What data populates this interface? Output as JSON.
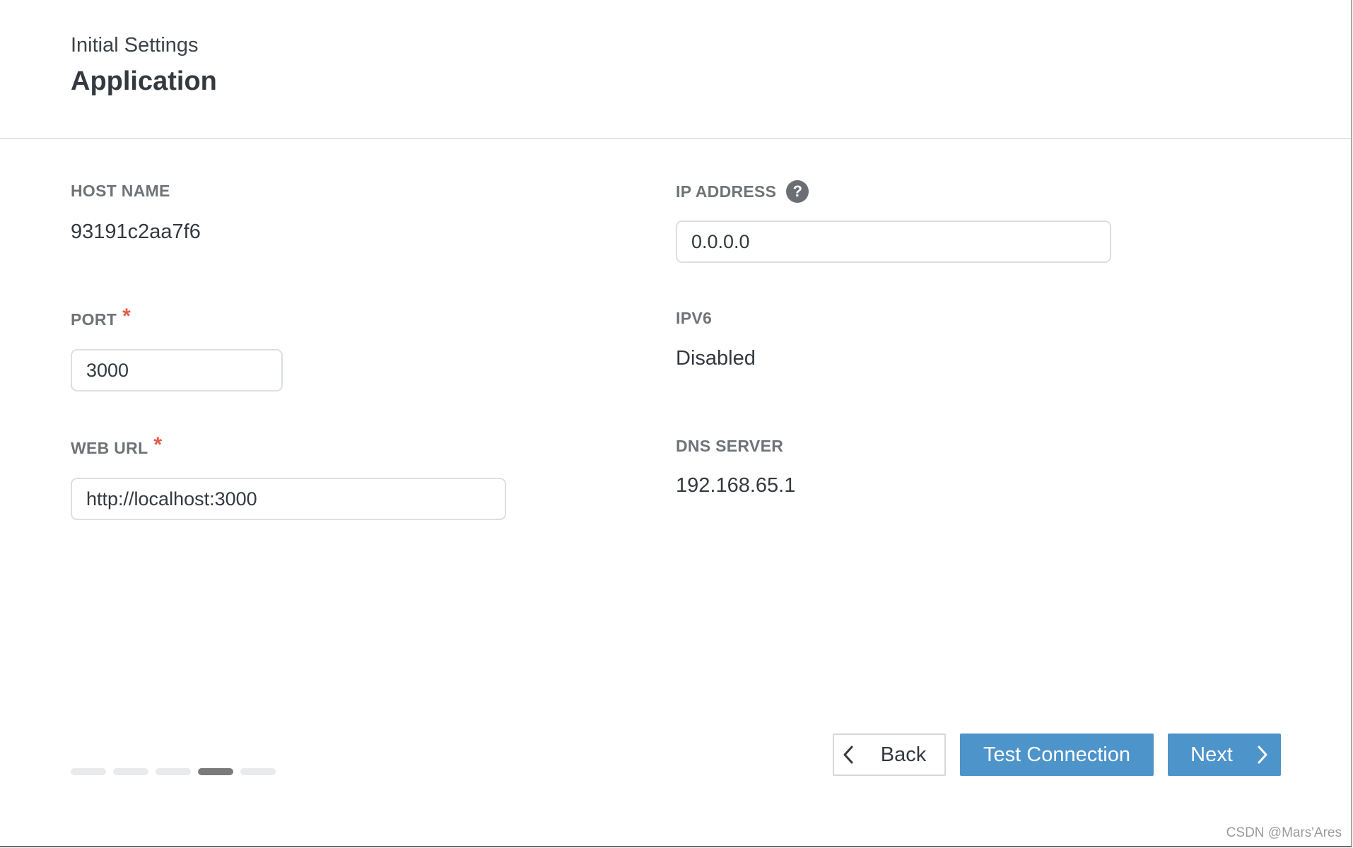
{
  "header": {
    "subtitle": "Initial Settings",
    "title": "Application"
  },
  "fields": {
    "host_name": {
      "label": "HOST NAME",
      "value": "93191c2aa7f6"
    },
    "ip_address": {
      "label": "IP ADDRESS",
      "help_icon": "?",
      "value": "0.0.0.0"
    },
    "port": {
      "label": "PORT",
      "required_mark": "*",
      "value": "3000"
    },
    "ipv6": {
      "label": "IPV6",
      "value": "Disabled"
    },
    "web_url": {
      "label": "WEB URL",
      "required_mark": "*",
      "value": "http://localhost:3000"
    },
    "dns_server": {
      "label": "DNS SERVER",
      "value": "192.168.65.1"
    }
  },
  "progress": {
    "total_steps": 5,
    "current_step": 4
  },
  "buttons": {
    "back": "Back",
    "test_connection": "Test Connection",
    "next": "Next"
  },
  "watermark": "CSDN @Mars'Ares",
  "colors": {
    "primary": "#4d94cb",
    "required": "#e25c4c",
    "label": "#6f7378",
    "text": "#33393f",
    "progress_active": "#7a7a7a",
    "progress_inactive": "#e9eaeb"
  },
  "icons": {
    "help": "question-circle-icon",
    "back": "chevron-left-icon",
    "next": "chevron-right-icon"
  }
}
